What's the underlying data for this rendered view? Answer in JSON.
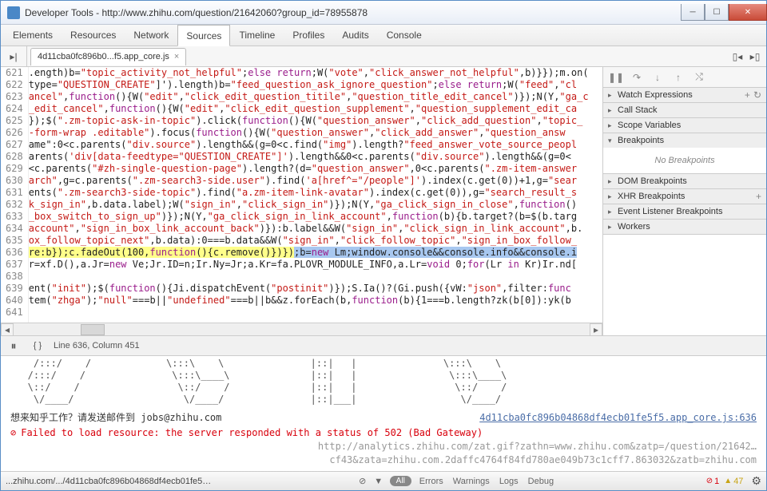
{
  "window": {
    "title": "Developer Tools - http://www.zhihu.com/question/21642060?group_id=78955878"
  },
  "tabs": [
    "Elements",
    "Resources",
    "Network",
    "Sources",
    "Timeline",
    "Profiles",
    "Audits",
    "Console"
  ],
  "source": {
    "tab": "4d11cba0fc896b0...f5.app_core.js",
    "first_line": "621",
    "cursor": "Line 636, Column 451"
  },
  "sidebar": {
    "0": "Watch Expressions",
    "1": "Call Stack",
    "2": "Scope Variables",
    "3": "Breakpoints",
    "4": "DOM Breakpoints",
    "5": "XHR Breakpoints",
    "6": "Event Listener Breakpoints",
    "7": "Workers",
    "breakpoints_empty": "No Breakpoints"
  },
  "console": {
    "recruit": "想来知乎工作？请发送邮件到 jobs@zhihu.com",
    "link": "4d11cba0fc896b04868df4ecb01fe5f5.app_core.js:636",
    "error": "Failed to load resource: the server responded with a status of 502 (Bad Gateway)",
    "grey1": "http://analytics.zhihu.com/zat.gif?zathn=www.zhihu.com&zatp=/question/21642…",
    "grey2": "cf43&zata=zhihu.com.2daffc4764f84fd780ae049b73c1cff7.863032&zatb=zhihu.com"
  },
  "status": {
    "path": "...zhihu.com/.../4d11cba0fc896b04868df4ecb01fe5f5.app...",
    "filters": [
      "All",
      "Errors",
      "Warnings",
      "Logs",
      "Debug"
    ],
    "errors": "1",
    "warnings": "47"
  }
}
